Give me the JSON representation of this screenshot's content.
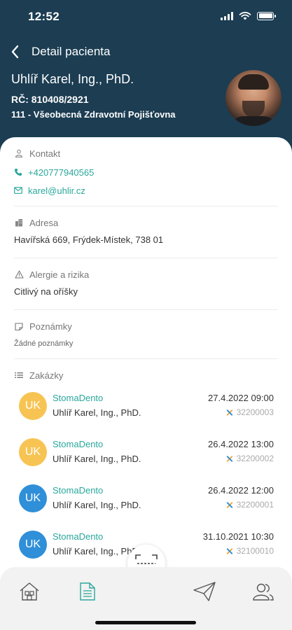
{
  "status": {
    "time": "12:52"
  },
  "nav": {
    "title": "Detail pacienta"
  },
  "patient": {
    "name": "Uhlíř Karel, Ing., PhD.",
    "rc": "RČ: 810408/2921",
    "insurance": "111 - Všeobecná Zdravotní Pojišťovna"
  },
  "contact": {
    "title": "Kontakt",
    "phone": "+420777940565",
    "email": "karel@uhlir.cz"
  },
  "address": {
    "title": "Adresa",
    "value": "Havířská 669, Frýdek-Místek, 738 01"
  },
  "allergies": {
    "title": "Alergie a rizika",
    "value": "Citlivý na oříšky"
  },
  "notes": {
    "title": "Poznámky",
    "value": "Žádné poznámky"
  },
  "orders": {
    "title": "Zakázky",
    "items": [
      {
        "initials": "UK",
        "lab": "StomaDento",
        "patient": "Uhlíř Karel, Ing., PhD.",
        "date": "27.4.2022 09:00",
        "number": "32200003",
        "badge_color": "#f7c453"
      },
      {
        "initials": "UK",
        "lab": "StomaDento",
        "patient": "Uhlíř Karel, Ing., PhD.",
        "date": "26.4.2022 13:00",
        "number": "32200002",
        "badge_color": "#f7c453"
      },
      {
        "initials": "UK",
        "lab": "StomaDento",
        "patient": "Uhlíř Karel, Ing., PhD.",
        "date": "26.4.2022 12:00",
        "number": "32200001",
        "badge_color": "#2f8fd8"
      },
      {
        "initials": "UK",
        "lab": "StomaDento",
        "patient": "Uhlíř Karel, Ing., PhD.",
        "date": "31.10.2021 10:30",
        "number": "32100010",
        "badge_color": "#2f8fd8"
      }
    ]
  },
  "colors": {
    "header_bg": "#1c3d52",
    "accent": "#2aa79b"
  },
  "tabs": [
    "home-icon",
    "document-icon",
    "scan-icon",
    "send-icon",
    "users-icon"
  ]
}
